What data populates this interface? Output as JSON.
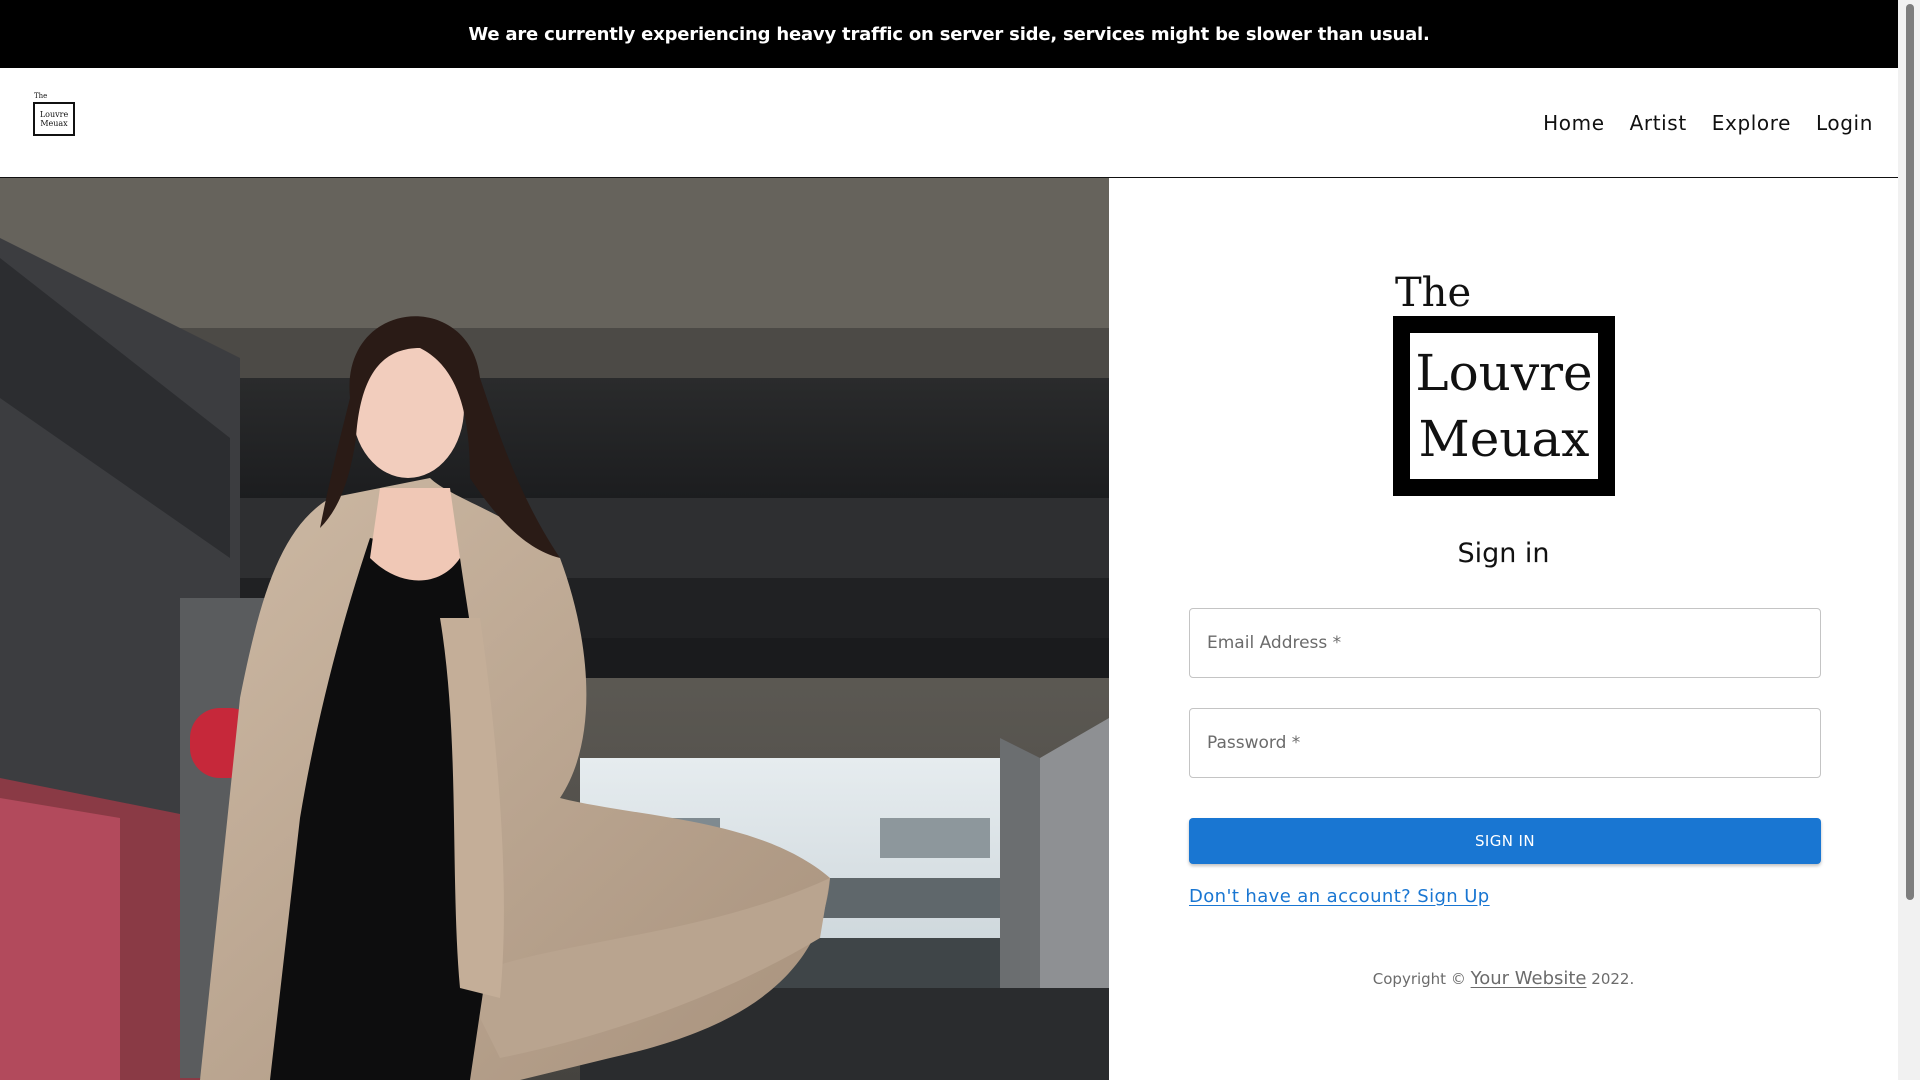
{
  "banner": {
    "text": "We are currently experiencing heavy traffic on server side, services might be slower than usual."
  },
  "navbar": {
    "logo": {
      "the": "The",
      "line1": "Louvre",
      "line2": "Meuax"
    },
    "links": [
      {
        "label": "Home"
      },
      {
        "label": "Artist"
      },
      {
        "label": "Explore"
      },
      {
        "label": "Login"
      }
    ]
  },
  "hero": {
    "image_icon": "photo-woman-trench-coat-underpass"
  },
  "signin": {
    "logo": {
      "the": "The",
      "line1": "Louvre",
      "line2": "Meuax"
    },
    "title": "Sign in",
    "email_placeholder": "Email Address *",
    "password_placeholder": "Password *",
    "submit_label": "SIGN IN",
    "signup_link": "Don't have an account? Sign Up",
    "copyright_prefix": "Copyright © ",
    "copyright_link": "Your Website",
    "copyright_suffix": " 2022."
  },
  "colors": {
    "banner_bg": "#000000",
    "primary": "#1976d2",
    "text": "#111111",
    "muted": "#6b6b6b"
  }
}
